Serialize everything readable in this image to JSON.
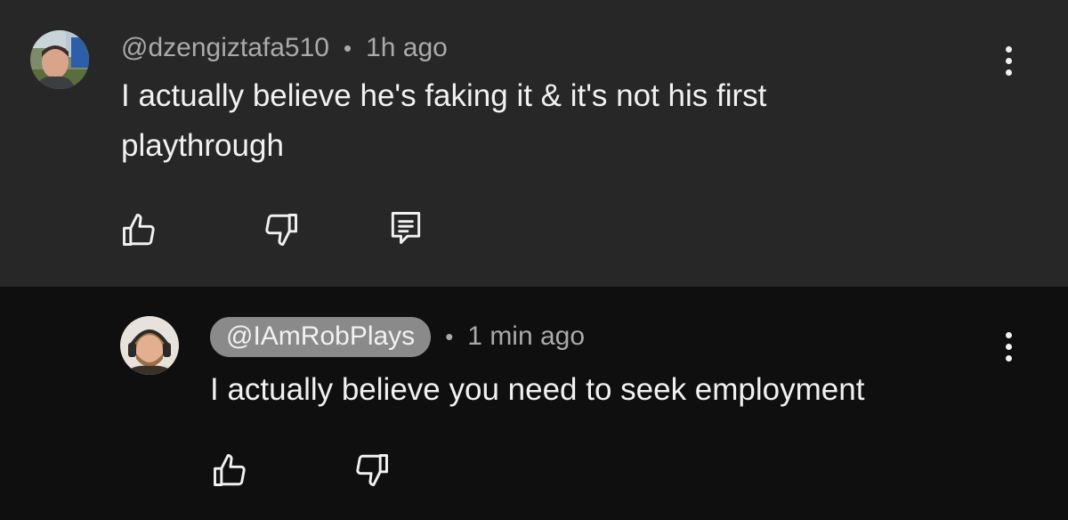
{
  "comments": [
    {
      "handle": "@dzengiztafa510",
      "separator": "•",
      "time": "1h ago",
      "text": "I actually believe he's faking it & it's not his first playthrough",
      "actions": [
        "like-icon",
        "dislike-icon",
        "reply-icon"
      ]
    },
    {
      "handle": "@IAmRobPlays",
      "separator": "•",
      "time": "1 min ago",
      "text": "I actually believe you need to seek employment",
      "actions": [
        "like-icon",
        "dislike-icon"
      ]
    }
  ],
  "colors": {
    "top_background": "#272727",
    "reply_background": "#0f0f0f",
    "primary_text": "#f1f1f1",
    "secondary_text": "#aaaaaa",
    "handle_pill": "#8a8a8a"
  },
  "icons": {
    "menu": "kebab-menu-icon",
    "like": "thumbs-up-icon",
    "dislike": "thumbs-down-icon",
    "reply": "comment-reply-icon"
  }
}
